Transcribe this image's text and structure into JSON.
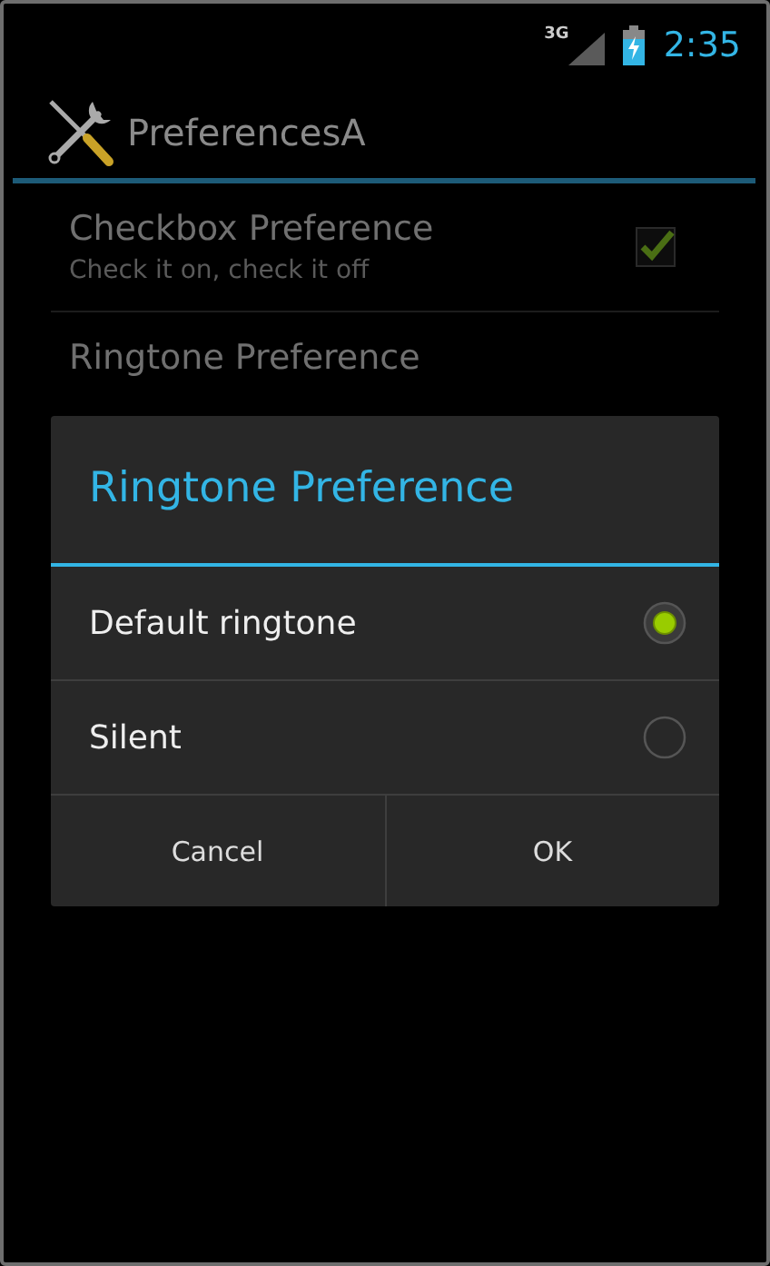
{
  "status_bar": {
    "network": "3G",
    "time": "2:35"
  },
  "action_bar": {
    "title": "PreferencesA"
  },
  "preferences": [
    {
      "kind": "checkbox",
      "title": "Checkbox Preference",
      "summary": "Check it on, check it off",
      "checked": true
    },
    {
      "kind": "plain",
      "title": "Ringtone Preference"
    }
  ],
  "dialog": {
    "title": "Ringtone Preference",
    "options": [
      {
        "label": "Default ringtone",
        "selected": true
      },
      {
        "label": "Silent",
        "selected": false
      }
    ],
    "buttons": [
      "Cancel",
      "OK"
    ]
  }
}
